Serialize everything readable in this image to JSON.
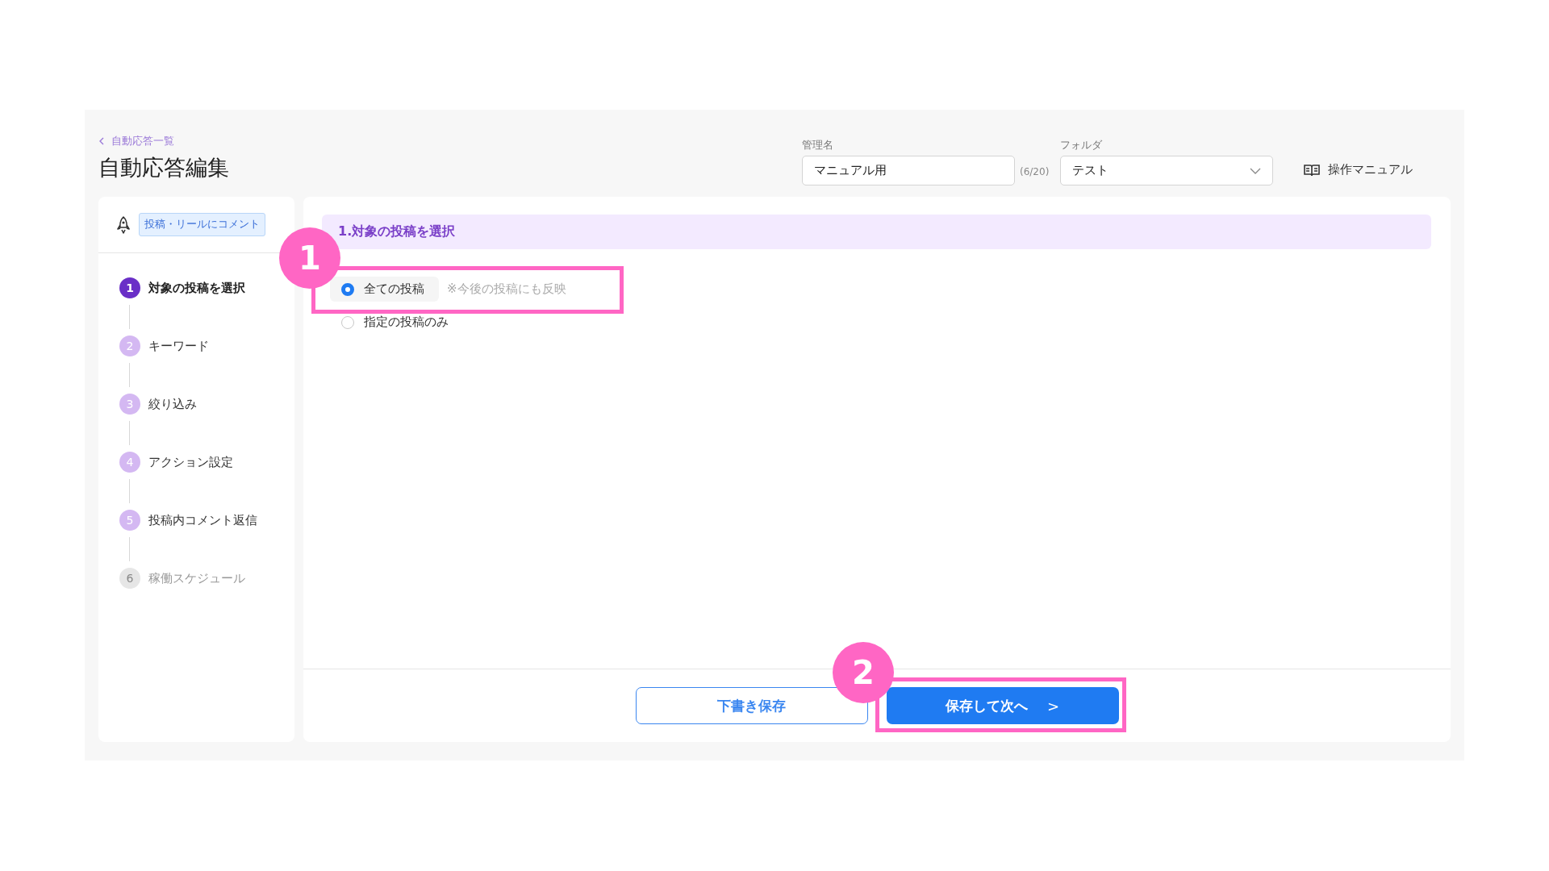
{
  "header": {
    "back_link": "自動応答一覧",
    "title": "自動応答編集",
    "name_field": {
      "label": "管理名",
      "value": "マニュアル用",
      "counter": "(6/20)"
    },
    "folder_field": {
      "label": "フォルダ",
      "value": "テスト"
    },
    "manual_link": "操作マニュアル"
  },
  "sidebar": {
    "tag": "投稿・リールにコメント",
    "steps": [
      {
        "number": "1",
        "label": "対象の投稿を選択",
        "selected": true,
        "disabled": false
      },
      {
        "number": "2",
        "label": "キーワード",
        "selected": false,
        "disabled": false
      },
      {
        "number": "3",
        "label": "絞り込み",
        "selected": false,
        "disabled": false
      },
      {
        "number": "4",
        "label": "アクション設定",
        "selected": false,
        "disabled": false
      },
      {
        "number": "5",
        "label": "投稿内コメント返信",
        "selected": false,
        "disabled": false
      },
      {
        "number": "6",
        "label": "稼働スケジュール",
        "selected": false,
        "disabled": true
      }
    ]
  },
  "section": {
    "title": "1.対象の投稿を選択",
    "options": [
      {
        "label": "全ての投稿",
        "note": "※今後の投稿にも反映",
        "selected": true
      },
      {
        "label": "指定の投稿のみ",
        "selected": false
      }
    ]
  },
  "footer": {
    "draft_button": "下書き保存",
    "next_button": "保存して次へ",
    "next_icon": ">"
  },
  "annotations": [
    {
      "label": "1"
    },
    {
      "label": "2"
    }
  ]
}
